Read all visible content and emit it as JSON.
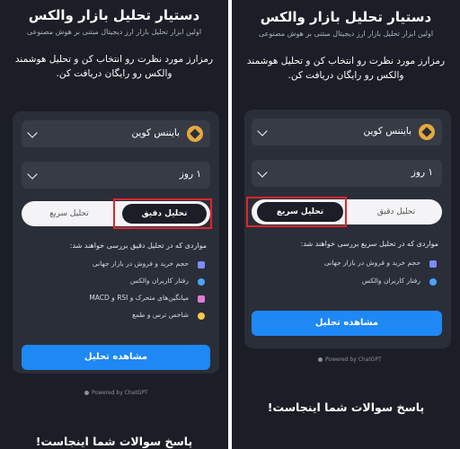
{
  "left": {
    "title": "دستیار تحلیل بازار والکس",
    "subtitle": "اولین ابزار تحلیل بازار ارز دیجیتال مبتنی بر هوش مصنوعی",
    "description": "رمزارز مورد نظرت رو انتخاب کن و تحلیل هوشمند والکس رو رایگان دریافت کن.",
    "coin_select": "بایننس کوین",
    "timeframe_select": "۱ روز",
    "tab_quick": "تحلیل سریع",
    "tab_precise": "تحلیل دقیق",
    "items_title": "مواردی که در تحلیل دقیق بررسی خواهند شد:",
    "items": [
      {
        "label": "حجم خرید و فروش در بازار جهانی",
        "icon": "chart-icon",
        "color": "#7b8cff"
      },
      {
        "label": "رفتار کاربران والکس",
        "icon": "search-icon",
        "color": "#4aa3ff"
      },
      {
        "label": "میانگین‌های متحرک و RSI و MACD",
        "icon": "trend-icon",
        "color": "#e07bd8"
      },
      {
        "label": "شاخص ترس و طمع",
        "icon": "emoji-icon",
        "color": "#f2c94c"
      }
    ],
    "button": "مشاهده تحلیل",
    "powered": "Powered by ChatGPT",
    "faq": "پاسخ سوالات شما اینجاست!"
  },
  "right": {
    "title": "دستیار تحلیل بازار والکس",
    "subtitle": "اولین ابزار تحلیل بازار ارز دیجیتال مبتنی بر هوش مصنوعی",
    "description": "رمزارز مورد نظرت رو انتخاب کن و تحلیل هوشمند والکس رو رایگان دریافت کن.",
    "coin_select": "بایننس کوین",
    "timeframe_select": "۱ روز",
    "tab_quick": "تحلیل سریع",
    "tab_precise": "تحلیل دقیق",
    "items_title": "مواردی که در تحلیل سریع بررسی خواهند شد:",
    "items": [
      {
        "label": "حجم خرید و فروش در بازار جهانی",
        "icon": "chart-icon",
        "color": "#7b8cff"
      },
      {
        "label": "رفتار کاربران والکس",
        "icon": "search-icon",
        "color": "#4aa3ff"
      }
    ],
    "button": "مشاهده تحلیل",
    "powered": "Powered by ChatGPT",
    "faq": "پاسخ سوالات شما اینجاست!"
  },
  "colors": {
    "accent": "#1e88f5",
    "highlight": "#e0252c",
    "panel_bg": "#1b1e26",
    "card_bg": "#2a2e38"
  }
}
